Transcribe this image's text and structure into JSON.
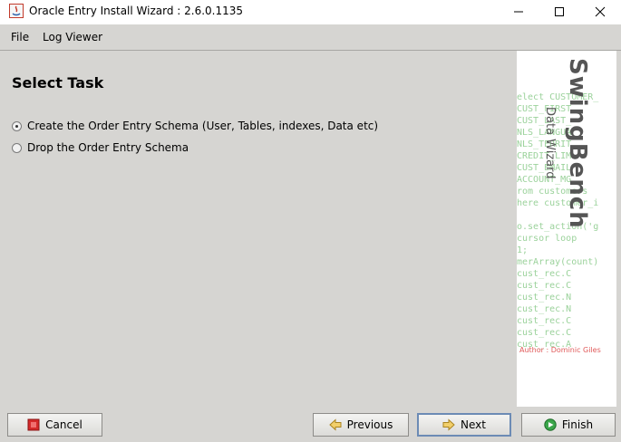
{
  "window": {
    "title": "Oracle Entry Install Wizard : 2.6.0.1135"
  },
  "menu": {
    "items": [
      "File",
      "Log Viewer"
    ]
  },
  "main": {
    "title": "Select Task",
    "options": [
      {
        "label": "Create the Order Entry Schema (User, Tables, indexes, Data etc)",
        "selected": true
      },
      {
        "label": "Drop the Order Entry Schema",
        "selected": false
      }
    ]
  },
  "side_panel": {
    "brand": "SwingBench",
    "subtitle": "Data Wizard",
    "author": "Author : Dominic Giles",
    "code_lines": [
      "elect CUSTOMER_",
      "     CUST_FIRST",
      "     CUST_LAST_",
      "     NLS_LANGUA",
      "     NLS_TERRIT",
      "     CREDIT_LIM",
      "     CUST_EMAIL",
      "     ACCOUNT_MG",
      "rom customers",
      "here customer_i",
      "",
      "o.set_action('g",
      " cursor loop",
      "1;",
      "merArray(count)",
      "       cust_rec.C",
      "       cust_rec.C",
      "       cust_rec.N",
      "       cust_rec.N",
      "       cust_rec.C",
      "       cust_rec.C",
      "       cust_rec.A"
    ]
  },
  "buttons": {
    "cancel": "Cancel",
    "previous": "Previous",
    "next": "Next",
    "finish": "Finish"
  },
  "colors": {
    "panel_bg": "#d6d5d2",
    "code_green": "#9bd29b",
    "author_red": "#e05a5a",
    "cancel_icon": "#d42a2a",
    "arrow_icon": "#e0b640",
    "finish_icon": "#3aa64a"
  }
}
